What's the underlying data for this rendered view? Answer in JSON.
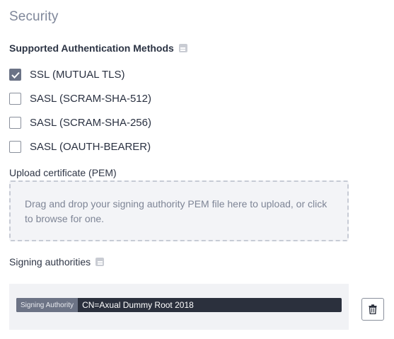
{
  "section": {
    "title": "Security"
  },
  "auth_methods": {
    "label": "Supported Authentication Methods",
    "options": [
      {
        "label": "SSL (MUTUAL TLS)",
        "checked": true
      },
      {
        "label": "SASL (SCRAM-SHA-512)",
        "checked": false
      },
      {
        "label": "SASL (SCRAM-SHA-256)",
        "checked": false
      },
      {
        "label": "SASL (OAUTH-BEARER)",
        "checked": false
      }
    ]
  },
  "upload": {
    "label": "Upload certificate (PEM)",
    "dropzone_text": "Drag and drop your signing authority PEM file here to upload, or click to browse for one."
  },
  "signing_authorities": {
    "label": "Signing authorities",
    "items": [
      {
        "tag": "Signing Authority",
        "value": "CN=Axual Dummy Root 2018"
      }
    ]
  },
  "colors": {
    "accent": "#6b7386",
    "chip_bg": "#2b303d",
    "panel_bg": "#f1f2f5"
  },
  "icons": {
    "info": "info-icon",
    "check": "check-icon",
    "delete": "trash-icon"
  }
}
